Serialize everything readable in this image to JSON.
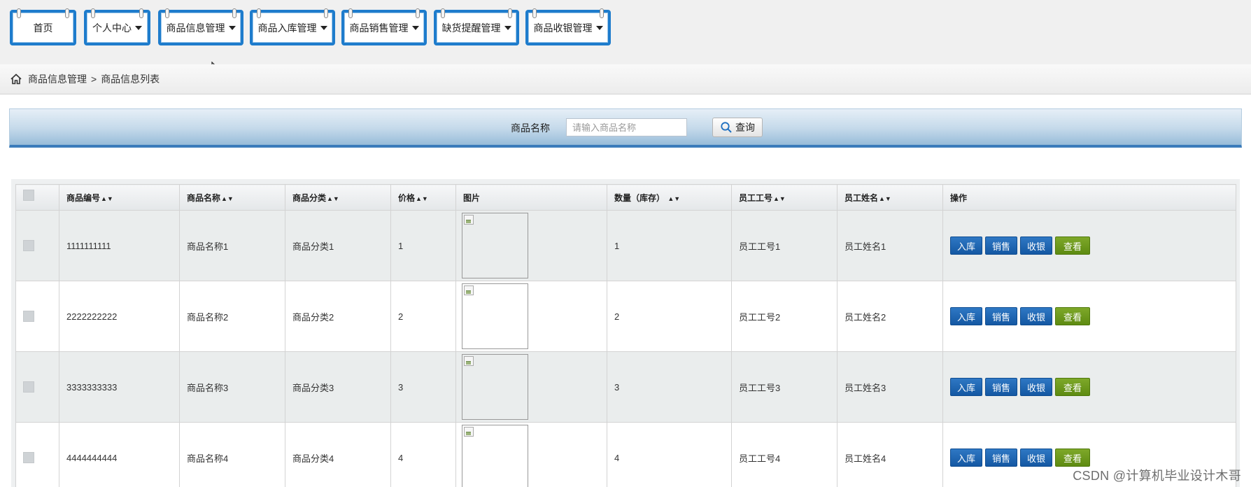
{
  "nav": {
    "items": [
      {
        "label": "首页",
        "dropdown": false
      },
      {
        "label": "个人中心",
        "dropdown": true
      },
      {
        "label": "商品信息管理",
        "dropdown": true
      },
      {
        "label": "商品入库管理",
        "dropdown": true
      },
      {
        "label": "商品销售管理",
        "dropdown": true
      },
      {
        "label": "缺货提醒管理",
        "dropdown": true
      },
      {
        "label": "商品收银管理",
        "dropdown": true
      }
    ],
    "accent": "#1e7ccc"
  },
  "breadcrumb": {
    "home_icon": "home-icon",
    "section": "商品信息管理",
    "separator": ">",
    "page": "商品信息列表"
  },
  "search": {
    "label": "商品名称",
    "placeholder": "请输入商品名称",
    "value": "",
    "button_label": "查询",
    "button_icon": "search-icon"
  },
  "table": {
    "columns": [
      "商品编号",
      "商品名称",
      "商品分类",
      "价格",
      "图片",
      "数量（库存）",
      "员工工号",
      "员工姓名",
      "操作"
    ],
    "sortable": [
      true,
      true,
      true,
      true,
      false,
      true,
      true,
      true,
      false
    ],
    "rows": [
      {
        "code": "1111111111",
        "name": "商品名称1",
        "category": "商品分类1",
        "price": "1",
        "qty": "1",
        "staff_no": "员工工号1",
        "staff_name": "员工姓名1"
      },
      {
        "code": "2222222222",
        "name": "商品名称2",
        "category": "商品分类2",
        "price": "2",
        "qty": "2",
        "staff_no": "员工工号2",
        "staff_name": "员工姓名2"
      },
      {
        "code": "3333333333",
        "name": "商品名称3",
        "category": "商品分类3",
        "price": "3",
        "qty": "3",
        "staff_no": "员工工号3",
        "staff_name": "员工姓名3"
      },
      {
        "code": "4444444444",
        "name": "商品名称4",
        "category": "商品分类4",
        "price": "4",
        "qty": "4",
        "staff_no": "员工工号4",
        "staff_name": "员工姓名4"
      }
    ],
    "actions": {
      "stock_in": "入库",
      "sell": "销售",
      "checkout": "收银",
      "view": "查看"
    },
    "colors": {
      "action_blue": "#1458a3",
      "action_green": "#5e8b12",
      "row_alt": "#eaeded"
    }
  },
  "watermark": "CSDN @计算机毕业设计木哥"
}
